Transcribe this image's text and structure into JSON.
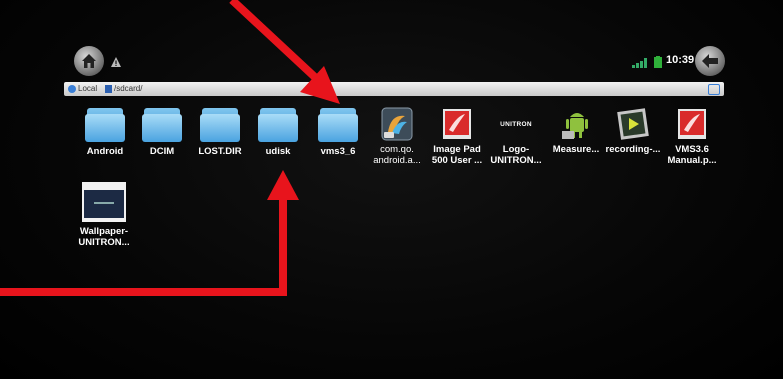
{
  "status_bar": {
    "time": "10:39",
    "icons": [
      "home-icon",
      "warning-icon",
      "signal-icon",
      "battery-icon",
      "back-icon"
    ]
  },
  "path_bar": {
    "location": "Local",
    "path": "/sdcard/"
  },
  "files": [
    {
      "label": "Android",
      "type": "folder"
    },
    {
      "label": "DCIM",
      "type": "folder"
    },
    {
      "label": "LOST.DIR",
      "type": "folder"
    },
    {
      "label": "udisk",
      "type": "folder"
    },
    {
      "label": "vms3_6",
      "type": "folder"
    },
    {
      "label": "com.qo.\nandroid.a...",
      "type": "apk"
    },
    {
      "label": "Image Pad\n500 User ...",
      "type": "pdf"
    },
    {
      "label": "Logo-\nUNITRON...",
      "type": "image",
      "text": "UNITRON"
    },
    {
      "label": "Measure...",
      "type": "android-app"
    },
    {
      "label": "recording-...",
      "type": "video"
    },
    {
      "label": "VMS3.6\nManual.p...",
      "type": "pdf"
    },
    {
      "label": "Wallpaper-\nUNITRON...",
      "type": "image"
    }
  ],
  "colors": {
    "annotation_arrow": "#e8141c",
    "folder": "#4aa3e0"
  }
}
